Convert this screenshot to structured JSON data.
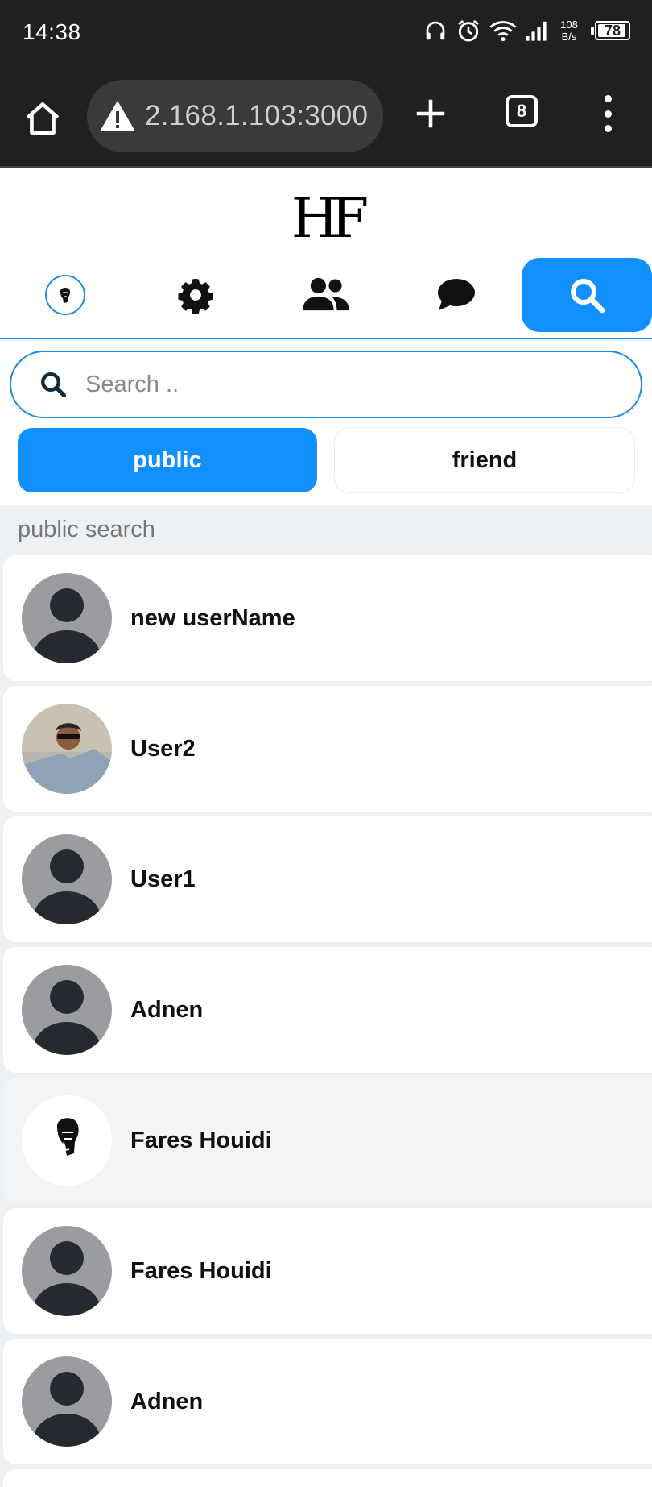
{
  "status_bar": {
    "time": "14:38",
    "net_speed_value": "108",
    "net_speed_unit": "B/s",
    "battery": "78",
    "icons": [
      "headphones-icon",
      "alarm-icon",
      "wifi-icon",
      "signal-icon",
      "battery-icon"
    ]
  },
  "browser": {
    "url": "2.168.1.103:3000",
    "tab_count": "8",
    "icons": [
      "home-icon",
      "warning-icon",
      "plus-icon",
      "tabs-icon",
      "menu-icon"
    ]
  },
  "app": {
    "logo": "HF",
    "nav": [
      "avatar",
      "settings-icon",
      "friends-icon",
      "chat-icon",
      "search-icon"
    ],
    "active_nav": "search",
    "accent_color": "#1290ff"
  },
  "search": {
    "placeholder": "Search ..",
    "value": ""
  },
  "filters": {
    "public_label": "public",
    "friend_label": "friend",
    "selected": "public"
  },
  "results": {
    "section_label": "public search",
    "users": [
      {
        "name": "new userName",
        "avatar": "default"
      },
      {
        "name": "User2",
        "avatar": "photo"
      },
      {
        "name": "User1",
        "avatar": "default"
      },
      {
        "name": "Adnen",
        "avatar": "default"
      },
      {
        "name": "Fares Houidi",
        "avatar": "sketch"
      },
      {
        "name": "Fares Houidi",
        "avatar": "default"
      },
      {
        "name": "Adnen",
        "avatar": "default"
      }
    ]
  }
}
